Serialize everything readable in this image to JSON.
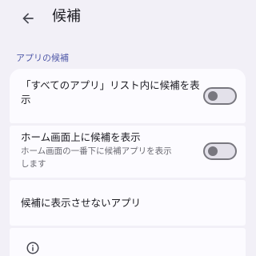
{
  "app_bar": {
    "back_icon": "arrow-back-icon",
    "title": "候補"
  },
  "section": {
    "header": "アプリの候補"
  },
  "settings": {
    "all_apps_suggestions": {
      "title": "「すべてのアプリ」リスト内に候補を表示",
      "enabled": false
    },
    "home_screen_suggestions": {
      "title": "ホーム画面上に候補を表示",
      "summary": "ホーム画面の一番下に候補アプリを表示します",
      "enabled": false
    },
    "hidden_apps": {
      "title": "候補に表示させないアプリ"
    },
    "info": {
      "icon": "info-icon"
    }
  },
  "colors": {
    "background": "#f2f0f7",
    "card": "#fcfbff",
    "accent": "#4e57a8",
    "switch_off": "#78777f"
  }
}
